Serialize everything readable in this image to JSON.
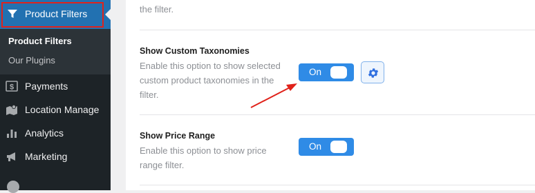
{
  "sidebar": {
    "active": {
      "label": "Product Filters",
      "icon": "filter-icon"
    },
    "submenu": [
      {
        "label": "Product Filters",
        "current": true
      },
      {
        "label": "Our Plugins",
        "current": false
      }
    ],
    "items": [
      {
        "label": "Payments",
        "icon": "dollar-icon"
      },
      {
        "label": "Location Manage",
        "icon": "map-icon"
      },
      {
        "label": "Analytics",
        "icon": "bar-chart-icon"
      },
      {
        "label": "Marketing",
        "icon": "megaphone-icon"
      }
    ],
    "colors": {
      "background": "#1d2327",
      "submenu_bg": "#2c3338",
      "active_bg": "#2271b1",
      "highlight_border": "#e0221a"
    }
  },
  "settings": {
    "top_text": "the filter.",
    "rows": [
      {
        "title": "Show Custom Taxonomies",
        "description": "Enable this option to show selected custom product taxonomies in the filter.",
        "toggle_label": "On",
        "has_gear": true
      },
      {
        "title": "Show Price Range",
        "description": "Enable this option to show price range filter.",
        "toggle_label": "On",
        "has_gear": false
      }
    ],
    "colors": {
      "toggle_on": "#2f8be6",
      "gear": "#2f6fe0",
      "annotation_arrow": "#e0221a"
    }
  }
}
